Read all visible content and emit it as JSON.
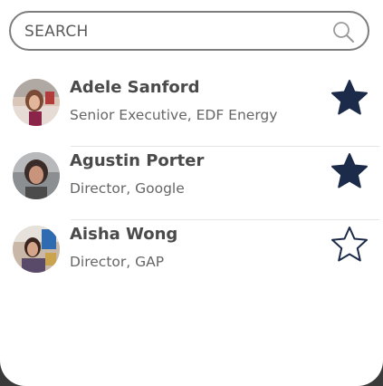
{
  "search": {
    "placeholder": "SEARCH"
  },
  "contacts": [
    {
      "name": "Adele Sanford",
      "role": "Senior Executive, EDF Energy",
      "favorite": true
    },
    {
      "name": "Agustin Porter",
      "role": "Director, Google",
      "favorite": true
    },
    {
      "name": "Aisha Wong",
      "role": "Director, GAP",
      "favorite": false
    }
  ],
  "colors": {
    "star_filled": "#1c2b4a",
    "star_outline": "#1c2b4a",
    "text_name": "#4a4a4a",
    "text_role": "#666666"
  }
}
